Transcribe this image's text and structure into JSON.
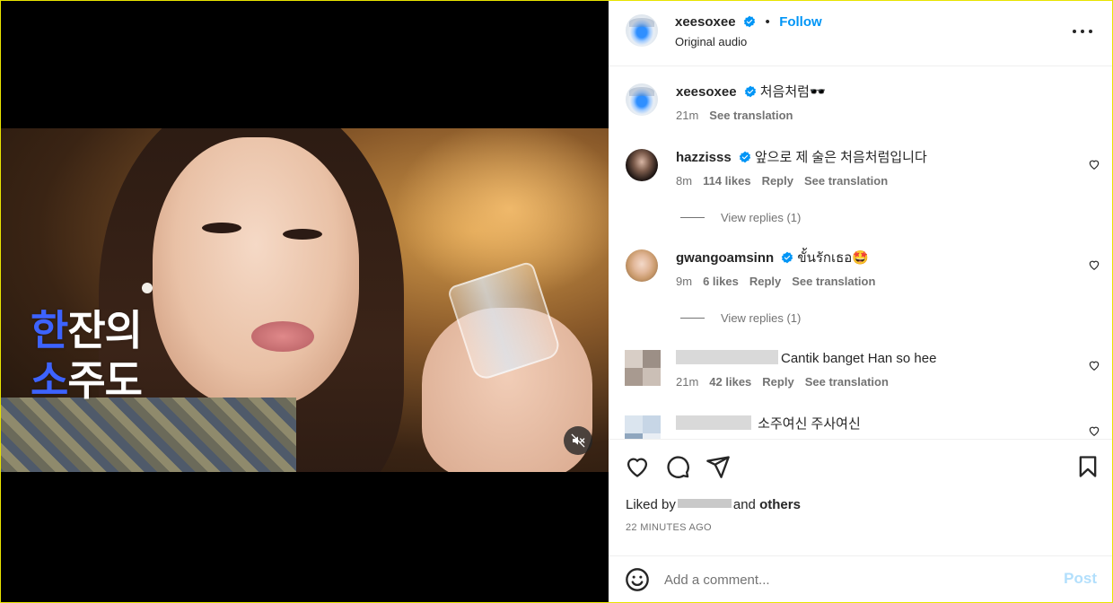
{
  "colors": {
    "accent": "#0095f6",
    "verified": "#0095f6",
    "text": "#262626",
    "muted": "#737373",
    "post_disabled": "#b2dffc",
    "heart": "#ed4956"
  },
  "video": {
    "overlay_line1_highlight": "한",
    "overlay_line1_rest": "잔의",
    "overlay_line2_highlight": "소",
    "overlay_line2_rest": "주도",
    "mute_icon": "speaker-muted-icon"
  },
  "header": {
    "username": "xeesoxee",
    "follow_label": "Follow",
    "separator": "•",
    "audio_label": "Original audio",
    "more_icon": "more-horizontal-icon"
  },
  "caption": {
    "username": "xeesoxee",
    "text": "처음처럼🕶️",
    "time": "21m",
    "see_translation": "See translation"
  },
  "comments": [
    {
      "username": "hazzisss",
      "text": "앞으로 제 술은 처음처럼입니다",
      "time": "8m",
      "likes": "114 likes",
      "reply": "Reply",
      "see_translation": "See translation",
      "view_replies": "View replies (1)"
    },
    {
      "username": "gwangoamsinn",
      "text": "ขั้นรักเธอ🤩",
      "time": "9m",
      "likes": "6 likes",
      "reply": "Reply",
      "see_translation": "See translation",
      "view_replies": "View replies (1)"
    },
    {
      "username": "",
      "text": "Cantik banget Han so hee",
      "time": "21m",
      "likes": "42 likes",
      "reply": "Reply",
      "see_translation": "See translation"
    },
    {
      "username": "",
      "text": "소주여신 주사여신"
    }
  ],
  "actions": {
    "like_icon": "heart-icon",
    "comment_icon": "comment-icon",
    "share_icon": "share-icon",
    "save_icon": "bookmark-icon",
    "liked_by_prefix": "Liked by",
    "liked_by_and": "and",
    "liked_by_others": "others",
    "time_ago": "22 MINUTES AGO"
  },
  "composer": {
    "placeholder": "Add a comment...",
    "post_label": "Post",
    "emoji_icon": "emoji-icon"
  }
}
